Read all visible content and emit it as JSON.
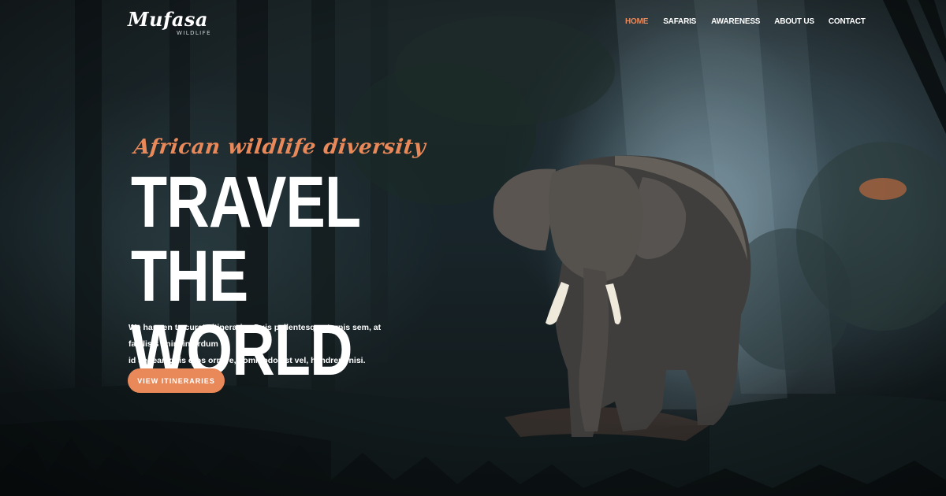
{
  "brand": {
    "logo_script": "Mufasa",
    "logo_sub": "WILDLIFE"
  },
  "nav": {
    "items": [
      {
        "label": "HOME",
        "active": true
      },
      {
        "label": "SAFARIS",
        "active": false
      },
      {
        "label": "AWARENESS",
        "active": false
      },
      {
        "label": "ABOUT US",
        "active": false
      },
      {
        "label": "CONTACT",
        "active": false
      }
    ]
  },
  "hero": {
    "tagline": "African wildlife diversity",
    "headline_line1": "TRAVEL THE",
    "headline_line2": "WORLD",
    "description_line1": "We happen to curate itineraries Duis pellentesque turpis sem, at facilisis enim interdum",
    "description_line2": "id aenean quis eros ornare, commodo est vel, hendrerit nisi.",
    "cta_label": "VIEW ITINERARIES",
    "background_image": "elephant-in-misty-forest"
  },
  "colors": {
    "accent": "#e9895a",
    "text": "#ffffff",
    "background": "#141d20"
  }
}
